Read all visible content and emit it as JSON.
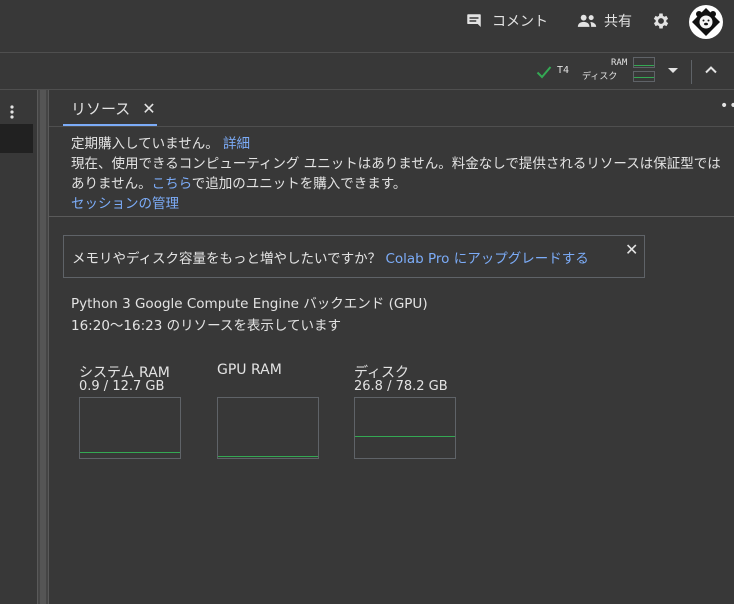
{
  "header": {
    "comment_label": "コメント",
    "share_label": "共有"
  },
  "runtime": {
    "gpu_type": "T4",
    "ram_label": "RAM",
    "disk_label": "ディスク",
    "ram_level": 0.07,
    "disk_level": 0.34
  },
  "panel": {
    "tab_label": "リソース",
    "tab_close": "✕",
    "more": "•••",
    "info": {
      "line1_text": "定期購入していません。",
      "line1_link": "詳細",
      "line2_text_a": "現在、使用できるコンピューティング ユニットはありません。料金なしで提供されるリソースは保証型ではありません。",
      "line2_link": "こちら",
      "line2_text_b": "で追加のユニットを購入できます。",
      "manage_link": "セッションの管理"
    },
    "upgrade": {
      "text": "メモリやディスク容量をもっと増やしたいですか？",
      "link": "Colab Pro にアップグレードする",
      "close": "✕"
    },
    "backend_line": "Python 3 Google Compute Engine バックエンド (GPU)",
    "time_range_line": "16:20～16:23 のリソースを表示しています",
    "gauges": [
      {
        "title": "システム RAM",
        "value": "0.9 / 12.7 GB",
        "level": 0.07
      },
      {
        "title": "GPU RAM",
        "value": "",
        "level": 0.0
      },
      {
        "title": "ディスク",
        "value": "26.8 / 78.2 GB",
        "level": 0.34
      }
    ]
  },
  "colors": {
    "background": "#383838",
    "accent_link": "#7cacf8",
    "usage_line": "#34a853"
  }
}
